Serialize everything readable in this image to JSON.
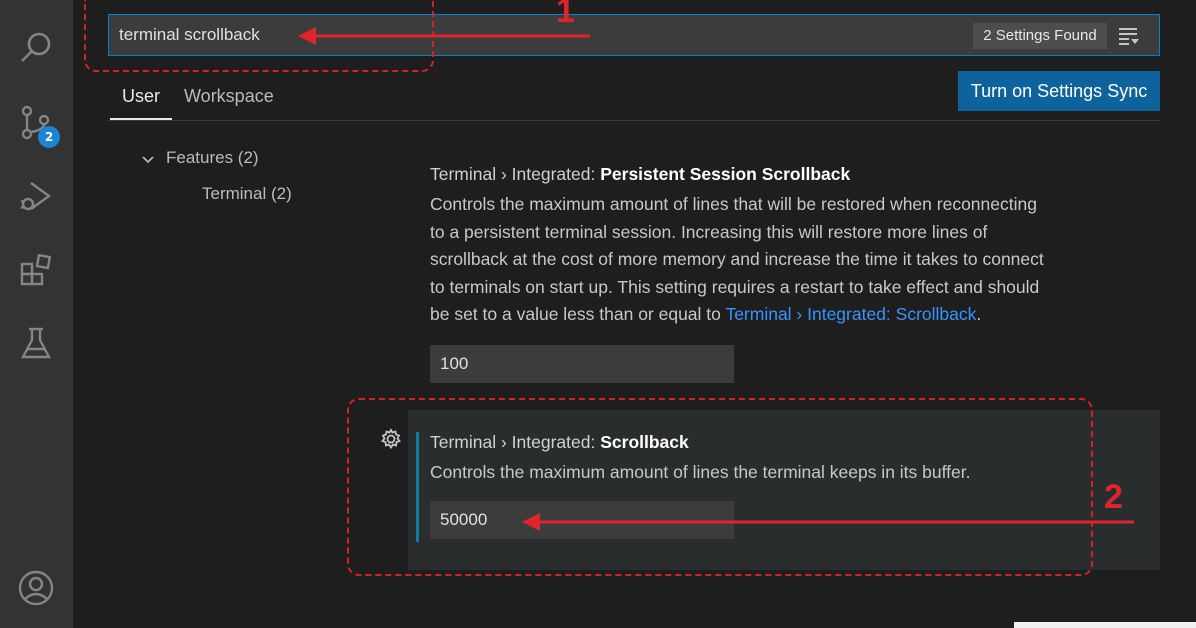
{
  "search": {
    "value": "terminal scrollback",
    "results_badge": "2 Settings Found"
  },
  "tabs": [
    {
      "label": "User",
      "active": true
    },
    {
      "label": "Workspace",
      "active": false
    }
  ],
  "sync_button": {
    "label": "Turn on Settings Sync"
  },
  "toc": {
    "group": "Features (2)",
    "item": "Terminal (2)"
  },
  "activity_bar": {
    "icons": [
      "search-icon",
      "source-control-icon",
      "run-debug-icon",
      "extensions-icon",
      "testing-icon",
      "account-icon"
    ],
    "source_control_badge": "2"
  },
  "settings": [
    {
      "category": "Terminal › Integrated:",
      "name": "Persistent Session Scrollback",
      "desc_lines": [
        "Controls the maximum amount of lines that will be restored when reconnecting",
        "to a persistent terminal session. Increasing this will restore more lines of",
        "scrollback at the cost of more memory and increase the time it takes to connect",
        "to terminals on start up. This setting requires a restart to take effect and should",
        "be set to a value less than or equal to"
      ],
      "desc_link": "Terminal › Integrated: Scrollback",
      "desc_end": ".",
      "value": "100"
    },
    {
      "category": "Terminal › Integrated:",
      "name": "Scrollback",
      "description": "Controls the maximum amount of lines the terminal keeps in its buffer.",
      "value": "50000"
    }
  ],
  "annotations": {
    "label_1": "1",
    "label_2": "2"
  },
  "colors": {
    "accent": "#0e639c",
    "annotation": "#d4212a",
    "link": "#3794ff",
    "badge": "#1a85d6"
  }
}
